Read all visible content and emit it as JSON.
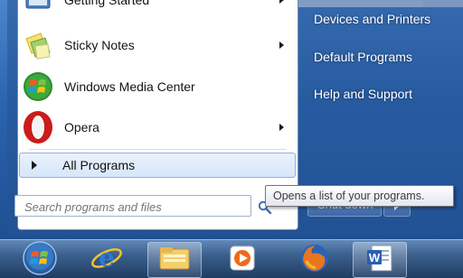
{
  "programs": [
    {
      "label": "Getting Started",
      "icon": "getting-started-icon",
      "has_arrow": true
    },
    {
      "label": "Sticky Notes",
      "icon": "sticky-notes-icon",
      "has_arrow": true
    },
    {
      "label": "Windows Media Center",
      "icon": "windows-media-center-icon",
      "has_arrow": false
    },
    {
      "label": "Opera",
      "icon": "opera-icon",
      "has_arrow": true
    }
  ],
  "all_programs_label": "All Programs",
  "search": {
    "placeholder": "Search programs and files"
  },
  "right_pane": {
    "items": [
      {
        "label": "Devices and Printers"
      },
      {
        "label": "Default Programs"
      },
      {
        "label": "Help and Support"
      }
    ]
  },
  "shutdown_label": "Shut down",
  "tooltip": {
    "text": "Opens a list of your programs."
  },
  "taskbar": {
    "items": [
      {
        "icon": "windows-start-icon",
        "active": false
      },
      {
        "icon": "internet-explorer-icon",
        "active": false
      },
      {
        "icon": "windows-explorer-icon",
        "active": true
      },
      {
        "icon": "windows-media-player-icon",
        "active": false
      },
      {
        "icon": "firefox-icon",
        "active": false
      },
      {
        "icon": "microsoft-word-icon",
        "active": true
      }
    ]
  },
  "colors": {
    "accent": "#2a63ad",
    "menu_white": "#ffffff",
    "hover_blue": "#d6e6fa",
    "opera_red": "#cc1b1b"
  }
}
